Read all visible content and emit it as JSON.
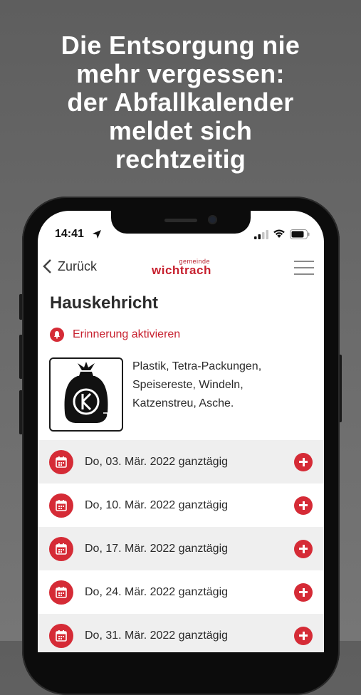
{
  "headline": [
    "Die Entsorgung nie",
    "mehr vergessen:",
    "der Abfallkalender",
    "meldet sich",
    "rechtzeitig"
  ],
  "status": {
    "time": "14:41"
  },
  "nav": {
    "back_label": "Zurück",
    "logo_small": "gemeinde",
    "logo_big": "wichtrach"
  },
  "page": {
    "title": "Hauskehricht",
    "reminder_label": "Erinnerung aktivieren",
    "description_lines": [
      "Plastik, Tetra-Packungen,",
      "Speisereste, Windeln,",
      "Katzenstreu, Asche."
    ]
  },
  "dates": [
    {
      "text": "Do, 03. Mär. 2022 ganztägig"
    },
    {
      "text": "Do, 10. Mär. 2022 ganztägig"
    },
    {
      "text": "Do, 17. Mär. 2022 ganztägig"
    },
    {
      "text": "Do, 24. Mär. 2022 ganztägig"
    },
    {
      "text": "Do, 31. Mär. 2022 ganztägig"
    }
  ],
  "colors": {
    "accent": "#d52b36",
    "row_shade": "#efefef",
    "background": "#666666"
  },
  "icons": [
    "location-arrow-icon",
    "signal-icon",
    "wifi-icon",
    "battery-icon",
    "chevron-left-icon",
    "hamburger-menu-icon",
    "bell-icon",
    "trash-bag-icon",
    "calendar-icon",
    "plus-circle-icon"
  ]
}
